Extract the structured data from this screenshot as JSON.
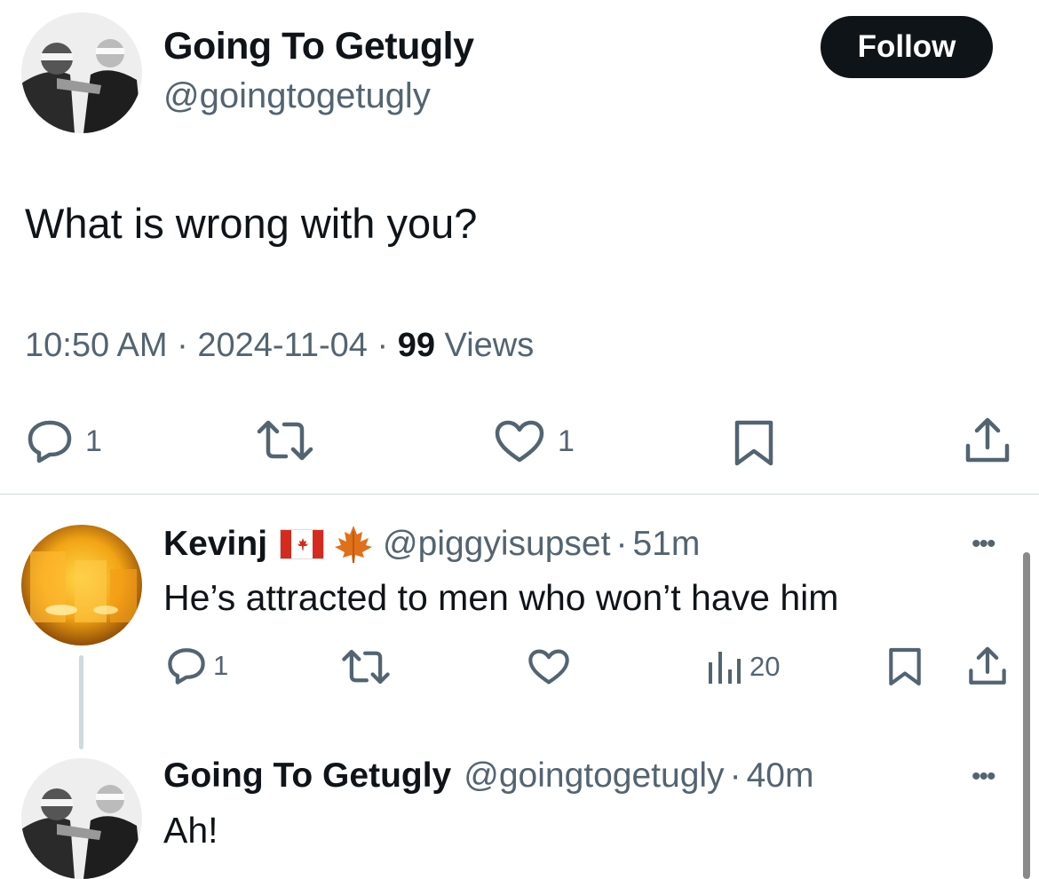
{
  "main_tweet": {
    "author_name": "Going To Getugly",
    "author_handle": "@goingtogetugly",
    "follow_label": "Follow",
    "text": "What is wrong with you?",
    "time": "10:50 AM",
    "sep1": "·",
    "date": "2024-11-04",
    "sep2": "·",
    "views_count": "99",
    "views_label": "Views",
    "actions": {
      "reply_count": "1",
      "like_count": "1"
    }
  },
  "replies": [
    {
      "author_name": "Kevinj",
      "author_handle": "@piggyisupset",
      "sep": "·",
      "time": "51m",
      "text": "He’s attracted to men who won’t have him",
      "more": "•••",
      "actions": {
        "reply_count": "1",
        "views_count": "20"
      }
    },
    {
      "author_name": "Going To Getugly",
      "author_handle": "@goingtogetugly",
      "sep": "·",
      "time": "40m",
      "text": "Ah!",
      "more": "•••"
    }
  ],
  "colors": {
    "text": "#0f1419",
    "secondary": "#536471",
    "button_bg": "#0f1419",
    "divider": "#cfd9de"
  }
}
